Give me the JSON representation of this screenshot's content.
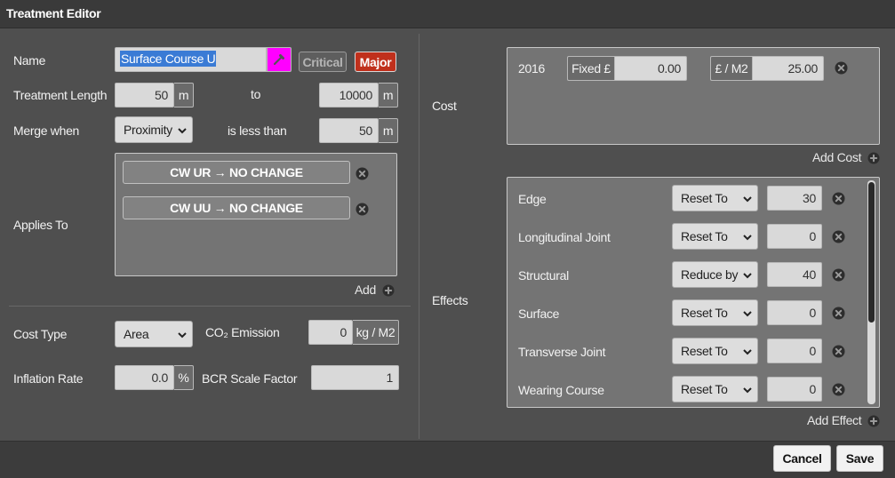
{
  "window": {
    "title": "Treatment Editor"
  },
  "name": {
    "label": "Name",
    "value": "Surface Course U",
    "critical_label": "Critical",
    "major_label": "Major",
    "color_swatch": "#ff00ff"
  },
  "length": {
    "label": "Treatment Length",
    "min": "50",
    "min_unit": "m",
    "to_label": "to",
    "max": "10000",
    "max_unit": "m"
  },
  "merge": {
    "label": "Merge when",
    "option": "Proximity",
    "less_label": "is less than",
    "value": "50",
    "unit": "m"
  },
  "applies": {
    "label": "Applies To",
    "items": [
      {
        "text": "CW UR → NO CHANGE"
      },
      {
        "text": "CW UU → NO CHANGE"
      }
    ],
    "add_label": "Add"
  },
  "cost_type": {
    "label": "Cost Type",
    "option": "Area"
  },
  "co2": {
    "label": "CO₂ Emission",
    "value": "0",
    "unit": "kg / M2"
  },
  "inflation": {
    "label": "Inflation Rate",
    "value": "0.0",
    "unit": "%"
  },
  "bcr": {
    "label": "BCR Scale Factor",
    "value": "1"
  },
  "cost": {
    "label": "Cost",
    "year": "2016",
    "fixed_prefix": "Fixed £",
    "fixed_value": "0.00",
    "rate_prefix": "£ / M2",
    "rate_value": "25.00",
    "add_label": "Add Cost"
  },
  "effects": {
    "label": "Effects",
    "items": [
      {
        "name": "Edge",
        "op": "Reset To",
        "value": "30"
      },
      {
        "name": "Longitudinal Joint",
        "op": "Reset To",
        "value": "0"
      },
      {
        "name": "Structural",
        "op": "Reduce by",
        "value": "40"
      },
      {
        "name": "Surface",
        "op": "Reset To",
        "value": "0"
      },
      {
        "name": "Transverse Joint",
        "op": "Reset To",
        "value": "0"
      },
      {
        "name": "Wearing Course",
        "op": "Reset To",
        "value": "0"
      }
    ],
    "add_label": "Add Effect"
  },
  "footer": {
    "cancel_label": "Cancel",
    "save_label": "Save"
  },
  "colors": {
    "major": "#c0301c",
    "selection": "#3a7bd5",
    "background": "#4f4f4f"
  }
}
